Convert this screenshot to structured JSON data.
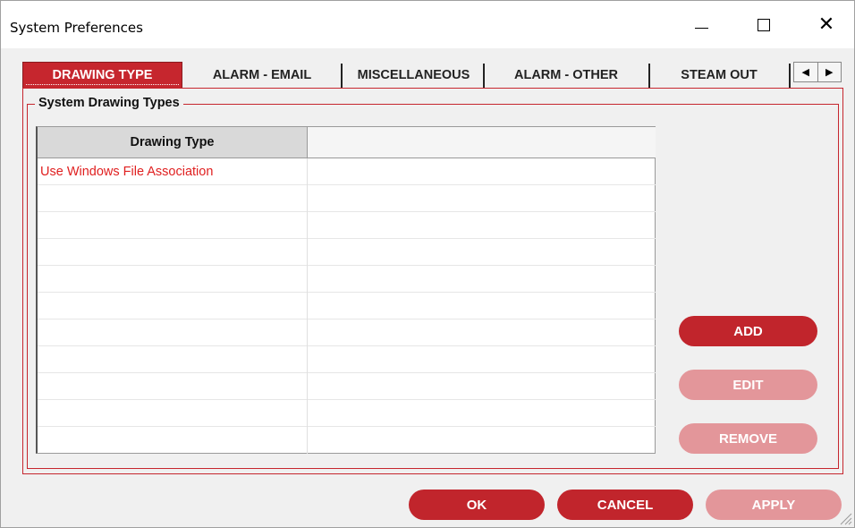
{
  "window": {
    "title": "System Preferences",
    "minimize_glyph": "—",
    "maximize_glyph": "☐",
    "close_glyph": "✕"
  },
  "tabs": [
    {
      "label": "DRAWING TYPE",
      "active": true
    },
    {
      "label": "ALARM - EMAIL",
      "active": false
    },
    {
      "label": "MISCELLANEOUS",
      "active": false
    },
    {
      "label": "ALARM - OTHER",
      "active": false
    },
    {
      "label": "STEAM OUT",
      "active": false
    }
  ],
  "tab_scroll": {
    "left": "◀",
    "right": "▶"
  },
  "group": {
    "title": "System Drawing Types"
  },
  "grid": {
    "columns": [
      "Drawing Type",
      ""
    ],
    "rows": [
      [
        "Use Windows File Association",
        ""
      ],
      [
        "",
        ""
      ],
      [
        "",
        ""
      ],
      [
        "",
        ""
      ],
      [
        "",
        ""
      ],
      [
        "",
        ""
      ],
      [
        "",
        ""
      ],
      [
        "",
        ""
      ],
      [
        "",
        ""
      ],
      [
        "",
        ""
      ],
      [
        "",
        ""
      ]
    ]
  },
  "side_buttons": {
    "add": "ADD",
    "edit": "EDIT",
    "remove": "REMOVE"
  },
  "footer_buttons": {
    "ok": "OK",
    "cancel": "CANCEL",
    "apply": "APPLY"
  },
  "colors": {
    "accent": "#c1252c",
    "accent_disabled": "#e3969a",
    "row_text": "#e02020"
  }
}
